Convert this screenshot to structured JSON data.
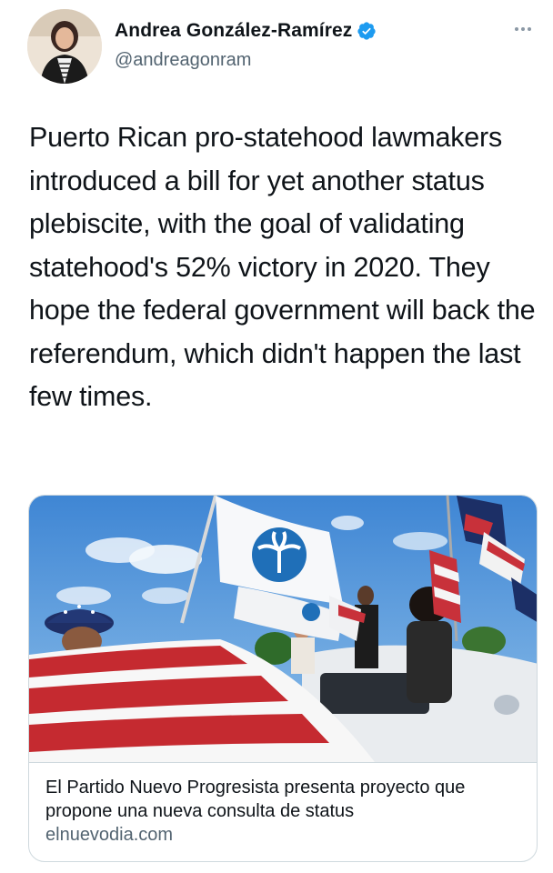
{
  "author": {
    "display_name": "Andrea González-Ramírez",
    "handle": "@andreagonram",
    "verified": true,
    "avatar_icon": "profile-photo",
    "verified_icon": "verified-badge-icon",
    "more_icon": "more-options-icon"
  },
  "tweet": {
    "text": "Puerto Rican pro-statehood lawmakers introduced a bill for yet another status plebiscite, with the goal of validating statehood's 52% victory in 2020. They hope the federal government will back the referendum, which didn't happen the last few times."
  },
  "link_card": {
    "title": "El Partido Nuevo Progresista presenta proyecto que propone una nueva consulta de status",
    "domain": "elnuevodia.com",
    "image_icon": "news-photo-flags"
  },
  "colors": {
    "text_primary": "#0f1419",
    "text_secondary": "#536471",
    "verified_blue": "#1d9bf0",
    "border": "#cfd9de"
  }
}
